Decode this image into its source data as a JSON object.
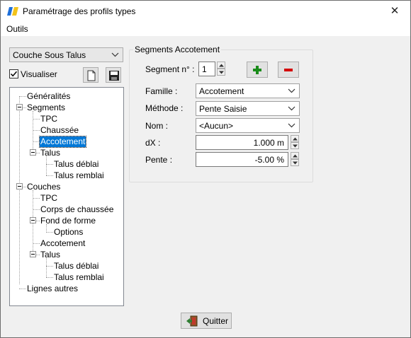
{
  "window": {
    "title": "Paramétrage des profils types",
    "close_glyph": "✕"
  },
  "menu": {
    "items": [
      "Outils"
    ]
  },
  "left": {
    "layer_combo": "Couche Sous Talus",
    "visualiser_label": "Visualiser",
    "visualiser_checked": true,
    "buttons": [
      "new-document-icon",
      "save-disk-icon"
    ]
  },
  "tree": {
    "items": [
      {
        "label": "Généralités"
      },
      {
        "label": "Segments"
      },
      {
        "label": "TPC"
      },
      {
        "label": "Chaussée"
      },
      {
        "label": "Accotement",
        "selected": true
      },
      {
        "label": "Talus"
      },
      {
        "label": "Talus déblai"
      },
      {
        "label": "Talus remblai"
      },
      {
        "label": "Couches"
      },
      {
        "label": "TPC"
      },
      {
        "label": "Corps de chaussée"
      },
      {
        "label": "Fond de forme"
      },
      {
        "label": "Options"
      },
      {
        "label": "Accotement"
      },
      {
        "label": "Talus"
      },
      {
        "label": "Talus déblai"
      },
      {
        "label": "Talus remblai"
      },
      {
        "label": "Lignes autres"
      }
    ]
  },
  "segment_panel": {
    "group_title": "Segments Accotement",
    "segment_label": "Segment n° :",
    "segment_value": "1",
    "add_icon": "plus-icon",
    "remove_icon": "minus-icon",
    "famille_label": "Famille :",
    "famille_value": "Accotement",
    "methode_label": "Méthode :",
    "methode_value": "Pente Saisie",
    "nom_label": "Nom :",
    "nom_value": "<Aucun>",
    "dx_label": "dX :",
    "dx_value": "1.000 m",
    "pente_label": "Pente :",
    "pente_value": "-5.00 %"
  },
  "footer": {
    "quit_label": "Quitter",
    "quit_icon": "exit-door-icon"
  },
  "colors": {
    "selection": "#0078d7",
    "add": "#1a8c1a",
    "remove": "#d40000"
  }
}
